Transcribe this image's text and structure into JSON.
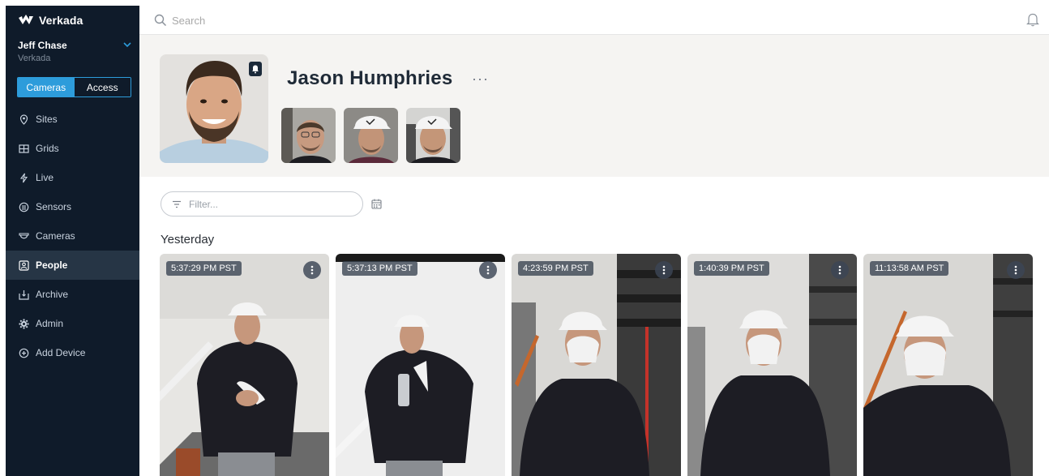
{
  "sidebar": {
    "brand": "Verkada",
    "user": {
      "name": "Jeff Chase",
      "org": "Verkada"
    },
    "toggle": {
      "cameras": "Cameras",
      "access": "Access"
    },
    "items": [
      {
        "label": "Sites",
        "icon": "map-pin-icon"
      },
      {
        "label": "Grids",
        "icon": "grid-icon"
      },
      {
        "label": "Live",
        "icon": "lightning-icon"
      },
      {
        "label": "Sensors",
        "icon": "sensor-icon"
      },
      {
        "label": "Cameras",
        "icon": "camera-icon"
      },
      {
        "label": "People",
        "icon": "person-icon",
        "active": true
      },
      {
        "label": "Archive",
        "icon": "archive-icon"
      },
      {
        "label": "Admin",
        "icon": "gear-icon"
      },
      {
        "label": "Add Device",
        "icon": "plus-circle-icon"
      }
    ]
  },
  "search": {
    "placeholder": "Search"
  },
  "profile": {
    "name": "Jason Humphries",
    "more": "···"
  },
  "filter": {
    "placeholder": "Filter..."
  },
  "section": {
    "label": "Yesterday"
  },
  "cards": [
    {
      "timestamp": "5:37:29 PM PST"
    },
    {
      "timestamp": "5:37:13 PM PST"
    },
    {
      "timestamp": "4:23:59 PM PST"
    },
    {
      "timestamp": "1:40:39 PM PST"
    },
    {
      "timestamp": "11:13:58 AM PST"
    }
  ],
  "colors": {
    "sidebar": "#0f1b2a",
    "accent": "#2d9cdb",
    "header_bg": "#f5f4f2"
  }
}
